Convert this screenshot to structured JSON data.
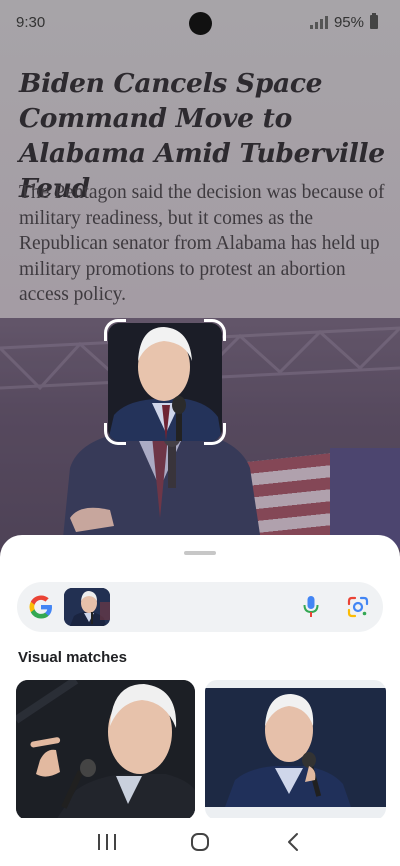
{
  "status_bar": {
    "time": "9:30",
    "battery": "95%"
  },
  "article": {
    "headline": "Biden Cancels Space Command Move to Alabama Amid Tuberville Feud",
    "summary": "The Pentagon said the decision was because of military readiness, but it comes as the Republican senator from Alabama has held up military promotions to protest an abortion access policy."
  },
  "lens_sheet": {
    "section_title": "Visual matches"
  },
  "icons": {
    "google": "google-g-icon",
    "mic": "microphone-icon",
    "lens": "google-lens-icon",
    "recents": "recents-icon",
    "home": "home-icon",
    "back": "back-icon"
  },
  "colors": {
    "google_blue": "#4285F4",
    "google_red": "#EA4335",
    "google_yellow": "#FBBC05",
    "google_green": "#34A853"
  }
}
